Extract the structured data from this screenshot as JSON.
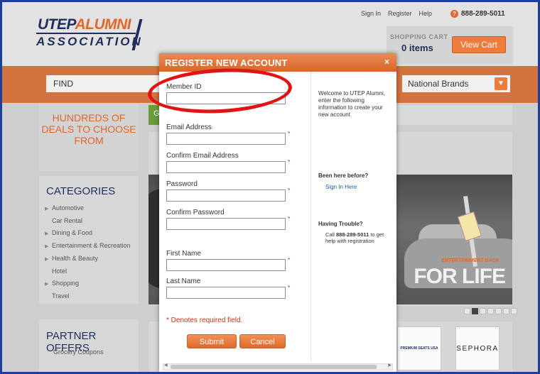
{
  "header": {
    "logo_top_1": "UTEP",
    "logo_top_2": "ALUMNI",
    "logo_bottom": "ASSOCIATION",
    "links": [
      "Sign In",
      "Register",
      "Help"
    ],
    "phone": "888-289-5011",
    "cart_label": "SHOPPING CART",
    "cart_items": "0 items",
    "view_cart": "View Cart"
  },
  "searchbar": {
    "find": "FIND",
    "brands": "National Brands"
  },
  "sidebar": {
    "deals": "HUNDREDS OF DEALS TO CHOOSE FROM",
    "categories_title": "CATEGORIES",
    "categories": [
      "Automotive",
      "Car Rental",
      "Dining & Food",
      "Entertainment & Recreation",
      "Health & Beauty",
      "Hotel",
      "Shopping",
      "Travel"
    ],
    "partner_title": "PARTNER OFFERS",
    "partner_link": "Grocery Coupons"
  },
  "main": {
    "green_letter": "G",
    "slide_small": "ENTERTAINMENT BACK",
    "slide_big": "FOR LIFE",
    "partner_logo_1": "PREMIUM SEATS USA",
    "partner_logo_2": "SEPHORA"
  },
  "modal": {
    "title": "REGISTER NEW ACCOUNT",
    "close": "×",
    "fields": [
      "Member ID",
      "Email Address",
      "Confirm Email Address",
      "Password",
      "Confirm Password",
      "First Name",
      "Last Name"
    ],
    "required_mark": "*",
    "required_note": "* Denotes required field.",
    "submit": "Submit",
    "cancel": "Cancel",
    "welcome": "Welcome to UTEP Alumni, enter the following information to create your new account",
    "been_here": "Been here before?",
    "sign_in_here": "Sign In Here",
    "trouble": "Having Trouble?",
    "help_pre": "Call ",
    "help_phone": "888-289-5011",
    "help_post": " to get help with registration"
  },
  "colors": {
    "accent": "#e2672a",
    "navy": "#1f2d5e",
    "highlight": "#e01414"
  }
}
